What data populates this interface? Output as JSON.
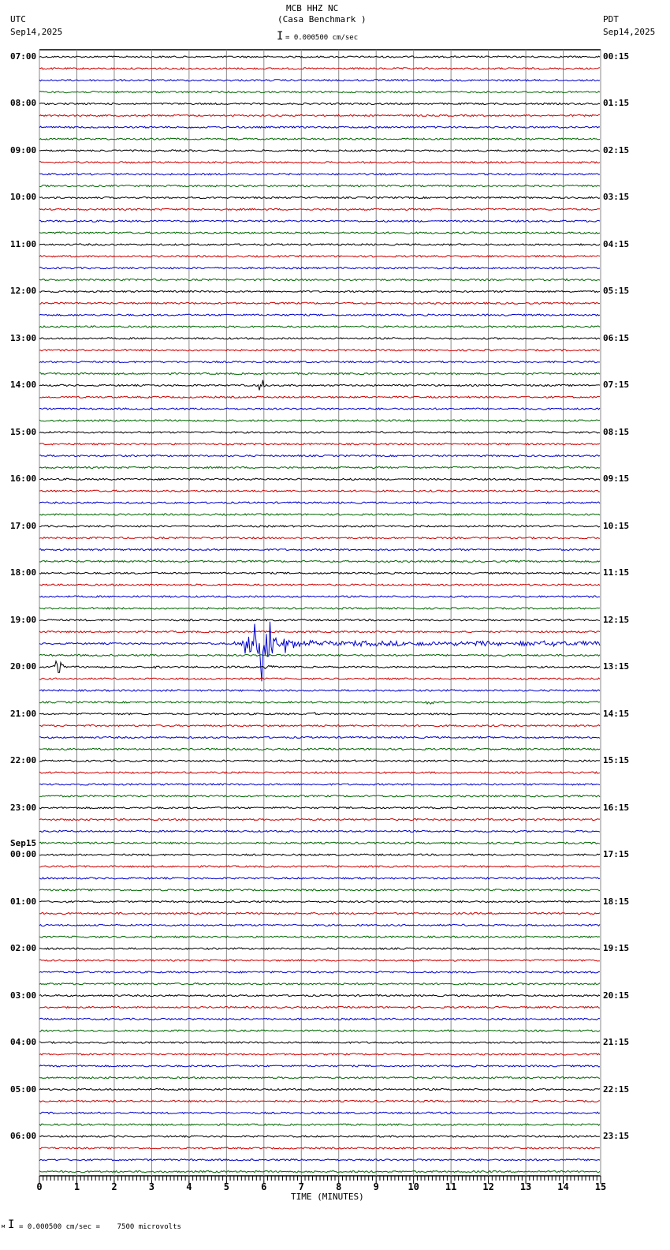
{
  "chart_data": {
    "type": "line",
    "title": "MCB HHZ NC",
    "subtitle": "(Casa Benchmark )",
    "left_timezone": "UTC",
    "left_date": "Sep14,2025",
    "right_timezone": "PDT",
    "right_date": "Sep14,2025",
    "scale_label": "= 0.000500 cm/sec",
    "footer_scale": "= 0.000500 cm/sec =    7500 microvolts",
    "xlabel": "TIME (MINUTES)",
    "xlim": [
      0,
      15
    ],
    "x_ticks": [
      "0",
      "1",
      "2",
      "3",
      "4",
      "5",
      "6",
      "7",
      "8",
      "9",
      "10",
      "11",
      "12",
      "13",
      "14",
      "15"
    ],
    "traces_per_hour": 4,
    "trace_colors": [
      "#000000",
      "#cc0000",
      "#0000cc",
      "#006600"
    ],
    "left_labels": [
      "07:00",
      "08:00",
      "09:00",
      "10:00",
      "11:00",
      "12:00",
      "13:00",
      "14:00",
      "15:00",
      "16:00",
      "17:00",
      "18:00",
      "19:00",
      "20:00",
      "21:00",
      "22:00",
      "23:00",
      "00:00",
      "01:00",
      "02:00",
      "03:00",
      "04:00",
      "05:00",
      "06:00"
    ],
    "date_change_label": "Sep15",
    "date_change_index": 17,
    "right_labels": [
      "00:15",
      "01:15",
      "02:15",
      "03:15",
      "04:15",
      "05:15",
      "06:15",
      "07:15",
      "08:15",
      "09:15",
      "10:15",
      "11:15",
      "12:15",
      "13:15",
      "14:15",
      "15:15",
      "16:15",
      "17:15",
      "18:15",
      "19:15",
      "20:15",
      "21:15",
      "22:15",
      "23:15"
    ],
    "events": [
      {
        "row": 28,
        "start_min": 5.7,
        "peak_min": 5.95,
        "end_min": 6.4,
        "amplitude": 12
      },
      {
        "row": 50,
        "start_min": 5.0,
        "peak_min": 6.0,
        "end_min": 8.8,
        "amplitude": 55,
        "coda_to_min": 15
      },
      {
        "row": 52,
        "start_min": 0.3,
        "peak_min": 0.55,
        "end_min": 1.0,
        "amplitude": 28
      },
      {
        "row": 52,
        "start_min": 3.0,
        "peak_min": 3.1,
        "end_min": 3.9,
        "amplitude": 6
      },
      {
        "row": 52,
        "start_min": 5.9,
        "peak_min": 6.0,
        "end_min": 7.3,
        "amplitude": 6
      },
      {
        "row": 55,
        "start_min": 9.5,
        "peak_min": 10.6,
        "end_min": 10.9,
        "amplitude": 5
      },
      {
        "row": 56,
        "start_min": 7.1,
        "peak_min": 7.3,
        "end_min": 8.8,
        "amplitude": 3
      }
    ]
  }
}
